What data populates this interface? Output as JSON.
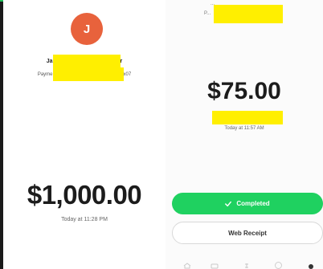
{
  "left_panel": {
    "avatar_initial": "J",
    "name_visible_left": "Ja",
    "name_visible_right": "r",
    "payment_method_visible_left": "Payme",
    "payment_method_visible_right": "x07",
    "amount": "$1,000.00",
    "timestamp": "Today at 11:28 PM"
  },
  "right_panel": {
    "top_text_line1": "...",
    "top_text_line2": "P...",
    "amount": "$75.00",
    "timestamp": "Today at 11:57 AM",
    "completed_label": "Completed",
    "web_receipt_label": "Web Receipt"
  },
  "colors": {
    "avatar": "#e8623c",
    "completed": "#1fd160",
    "redaction": "#ffef00"
  },
  "icons": {
    "checkmark": "check-icon",
    "bottom_nav": [
      "home-icon",
      "card-icon",
      "dollar-icon",
      "clock-icon",
      "profile-icon"
    ]
  }
}
